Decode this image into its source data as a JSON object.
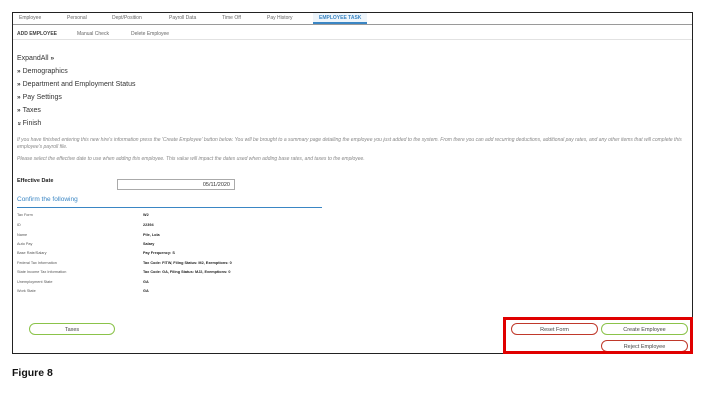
{
  "tabs": [
    {
      "label": "Employee"
    },
    {
      "label": "Personal"
    },
    {
      "label": "Dept/Position"
    },
    {
      "label": "Payroll Data"
    },
    {
      "label": "Time Off"
    },
    {
      "label": "Pay History"
    },
    {
      "label": "EMPLOYEE TASK"
    }
  ],
  "subtabs": [
    {
      "label": "ADD EMPLOYEE"
    },
    {
      "label": "Manual Check"
    },
    {
      "label": "Delete Employee"
    }
  ],
  "sections": {
    "expand_all": "ExpandAll",
    "items": [
      {
        "label": "Demographics"
      },
      {
        "label": "Department and Employment Status"
      },
      {
        "label": "Pay Settings"
      },
      {
        "label": "Taxes"
      },
      {
        "label": "Finish"
      }
    ]
  },
  "info": {
    "para1": "If you have finished entering this new hire's information press the 'Create Employee' button below. You will be brought to a summary page detailing the employee you just added to the system. From there you can add recurring deductions, additional pay rates, and any other items that will complete this employee's payroll file.",
    "para2": "Please select the effective date to use when adding this employee. This value will impact the dates used when adding base rates, and taxes to the employee."
  },
  "effective_date": {
    "label": "Effective Date",
    "value": "05/11/2020"
  },
  "confirm": {
    "title": "Confirm the following",
    "rows": [
      {
        "key": "Tax Form",
        "value": "W2"
      },
      {
        "key": "ID",
        "value": "22394"
      },
      {
        "key": "Name",
        "value": "Pile, Lola"
      },
      {
        "key": "Auto Pay",
        "value": "Salary"
      },
      {
        "key": "Base Rate/Salary",
        "value": "Pay Frequency: S"
      },
      {
        "key": "Federal Tax Information",
        "value": "Tax Code: FITW, Filing Status: M2, Exemptions: 0"
      },
      {
        "key": "State Income Tax Information",
        "value": "Tax Code: GA, Filing Status: MJ2, Exemptions: 0"
      },
      {
        "key": "Unemployment State",
        "value": "GA"
      },
      {
        "key": "Work State",
        "value": "GA"
      }
    ]
  },
  "buttons": {
    "taxes": "Taxes",
    "reset": "Reset Form",
    "create": "Create Employee",
    "reject": "Reject Employee"
  },
  "colors": {
    "accent": "#3a86c4",
    "green": "#8bc34a",
    "red": "#c0392b",
    "highlight": "#e00000"
  },
  "caption": "Figure 8"
}
